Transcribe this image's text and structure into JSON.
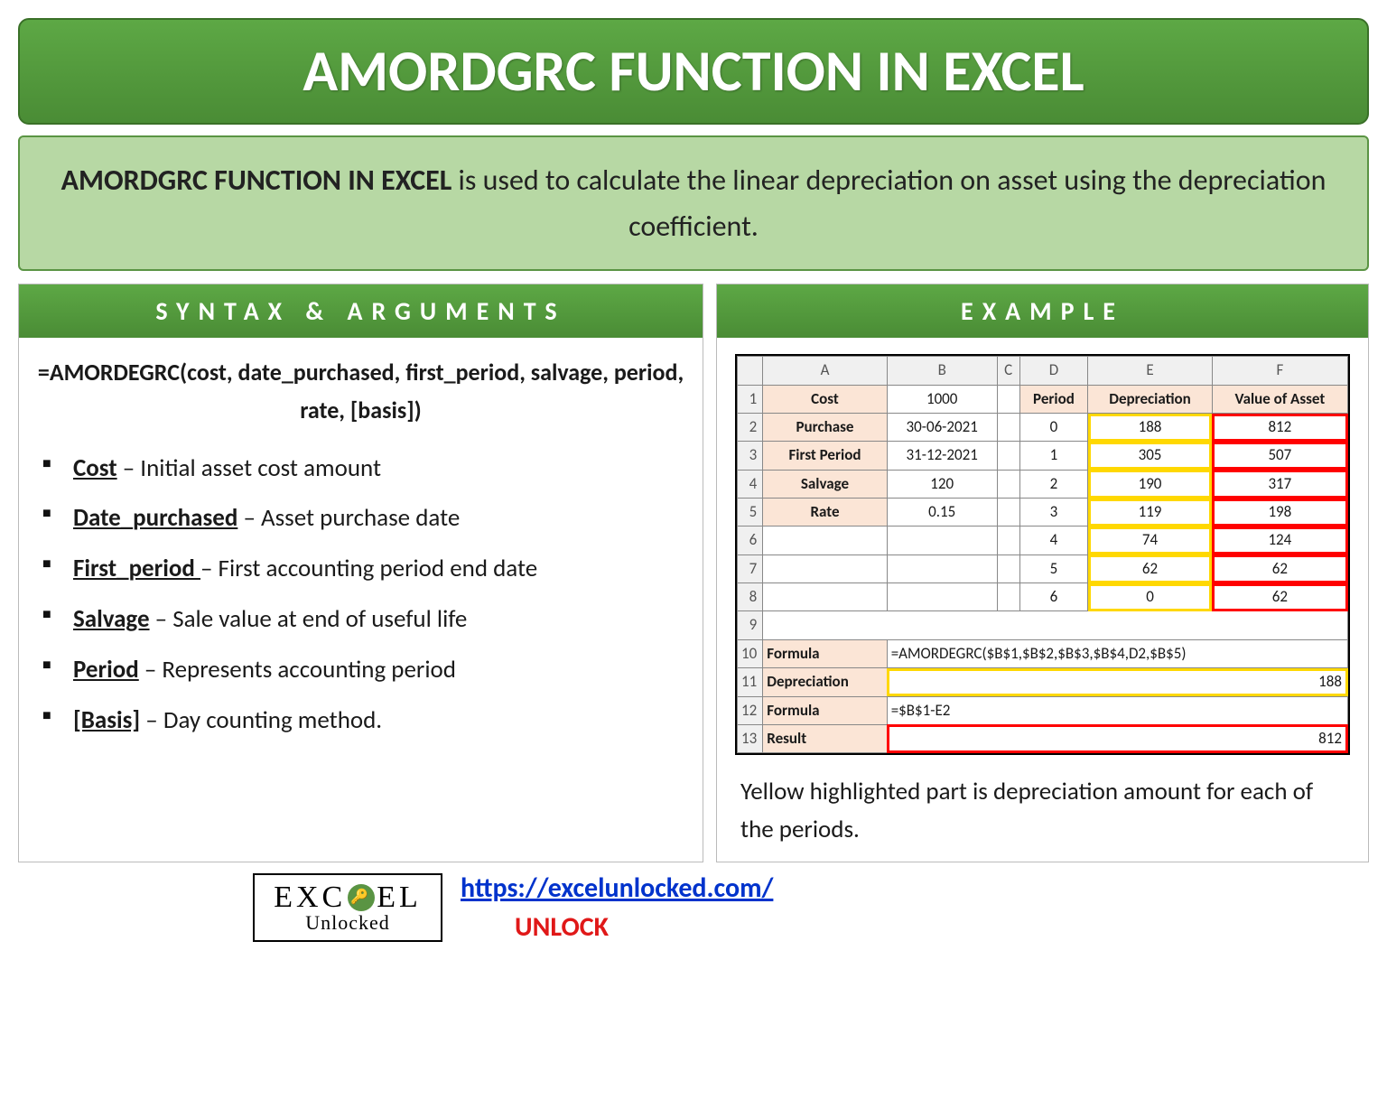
{
  "title": "AMORDGRC FUNCTION IN EXCEL",
  "description": {
    "bold_lead": "AMORDGRC FUNCTION IN EXCEL",
    "rest": " is used to calculate the linear depreciation on asset using the depreciation coefficient."
  },
  "left": {
    "heading": "SYNTAX & ARGUMENTS",
    "syntax": "=AMORDEGRC(cost, date_purchased, first_period, salvage, period, rate, [basis])",
    "args": [
      {
        "name": "Cost",
        "desc": " – Initial asset cost amount"
      },
      {
        "name": "Date_purchased",
        "desc": " – Asset purchase date"
      },
      {
        "name": "First_period ",
        "desc": "– First accounting period end date"
      },
      {
        "name": "Salvage",
        "desc": " – Sale value at end of useful life"
      },
      {
        "name": "Period",
        "desc": " – Represents accounting period"
      },
      {
        "name": "[Basis]",
        "desc": " – Day counting method."
      }
    ]
  },
  "right": {
    "heading": "EXAMPLE",
    "cols": [
      "A",
      "B",
      "C",
      "D",
      "E",
      "F"
    ],
    "left_params": [
      {
        "label": "Cost",
        "value": "1000"
      },
      {
        "label": "Purchase",
        "value": "30-06-2021"
      },
      {
        "label": "First Period",
        "value": "31-12-2021"
      },
      {
        "label": "Salvage",
        "value": "120"
      },
      {
        "label": "Rate",
        "value": "0.15"
      }
    ],
    "right_headers": {
      "d": "Period",
      "e": "Depreciation",
      "f": "Value of Asset"
    },
    "right_rows": [
      {
        "period": "0",
        "dep": "188",
        "val": "812"
      },
      {
        "period": "1",
        "dep": "305",
        "val": "507"
      },
      {
        "period": "2",
        "dep": "190",
        "val": "317"
      },
      {
        "period": "3",
        "dep": "119",
        "val": "198"
      },
      {
        "period": "4",
        "dep": "74",
        "val": "124"
      },
      {
        "period": "5",
        "dep": "62",
        "val": "62"
      },
      {
        "period": "6",
        "dep": "0",
        "val": "62"
      }
    ],
    "formula1_label": "Formula",
    "formula1_value": "=AMORDEGRC($B$1,$B$2,$B$3,$B$4,D2,$B$5)",
    "dep_label": "Depreciation",
    "dep_value": "188",
    "formula2_label": "Formula",
    "formula2_value": "=$B$1-E2",
    "result_label": "Result",
    "result_value": "812",
    "note": "Yellow highlighted part is depreciation amount for each of the periods."
  },
  "footer": {
    "logo_top_pre": "EXC",
    "logo_top_post": "EL",
    "logo_key_glyph": "🔑",
    "logo_bottom": "Unlocked",
    "url": "https://excelunlocked.com/",
    "unlock": "UNLOCK"
  }
}
